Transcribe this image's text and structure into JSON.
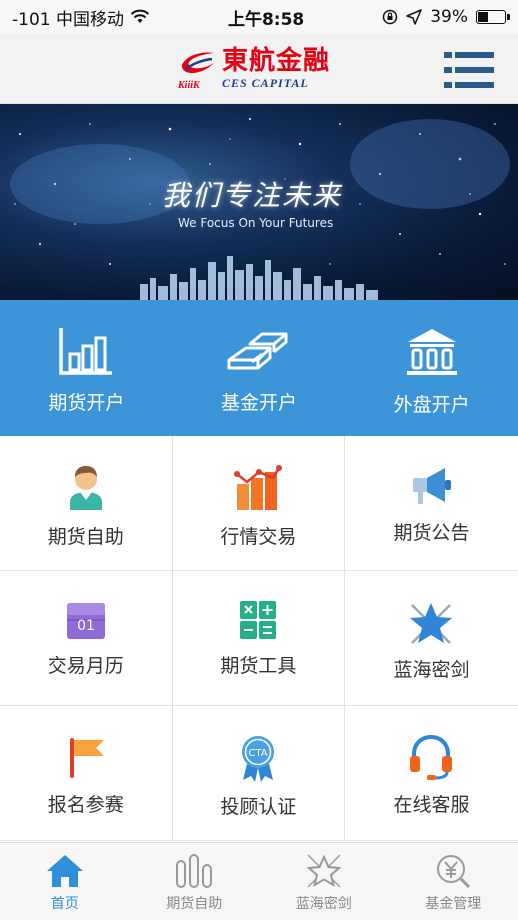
{
  "status_bar": {
    "carrier": "-101 中国移动",
    "time": "上午8:58",
    "battery": "39%",
    "battery_level": 0.39
  },
  "header": {
    "logo_cn": "東航金融",
    "logo_en": "CES CAPITAL",
    "logo_mark_text": "KiiiK",
    "menu_icon": "list-menu-icon"
  },
  "banner": {
    "slogan_cn": "我们专注未来",
    "slogan_en": "We Focus On Your Futures"
  },
  "primary_actions": [
    {
      "label": "期货开户",
      "icon": "bar-chart-icon"
    },
    {
      "label": "基金开户",
      "icon": "gold-bars-icon"
    },
    {
      "label": "外盘开户",
      "icon": "bank-icon"
    }
  ],
  "grid_items": [
    {
      "label": "期货自助",
      "icon": "user-icon"
    },
    {
      "label": "行情交易",
      "icon": "market-chart-icon"
    },
    {
      "label": "期货公告",
      "icon": "megaphone-icon"
    },
    {
      "label": "交易月历",
      "icon": "calendar-icon",
      "icon_text": "01"
    },
    {
      "label": "期货工具",
      "icon": "calculator-icon"
    },
    {
      "label": "蓝海密剑",
      "icon": "star-swords-icon"
    },
    {
      "label": "报名参赛",
      "icon": "flag-icon"
    },
    {
      "label": "投顾认证",
      "icon": "cta-badge-icon",
      "icon_text": "CTA"
    },
    {
      "label": "在线客服",
      "icon": "headset-icon"
    }
  ],
  "tabbar": [
    {
      "label": "首页",
      "icon": "home-icon",
      "active": true
    },
    {
      "label": "期货自助",
      "icon": "bars-icon",
      "active": false
    },
    {
      "label": "蓝海密剑",
      "icon": "star-swords-icon",
      "active": false
    },
    {
      "label": "基金管理",
      "icon": "yen-wrench-icon",
      "active": false
    }
  ],
  "colors": {
    "brand_red": "#e60012",
    "brand_navy": "#1a3d8f",
    "primary_blue": "#3c95d9",
    "tab_active": "#2f8fd8"
  }
}
